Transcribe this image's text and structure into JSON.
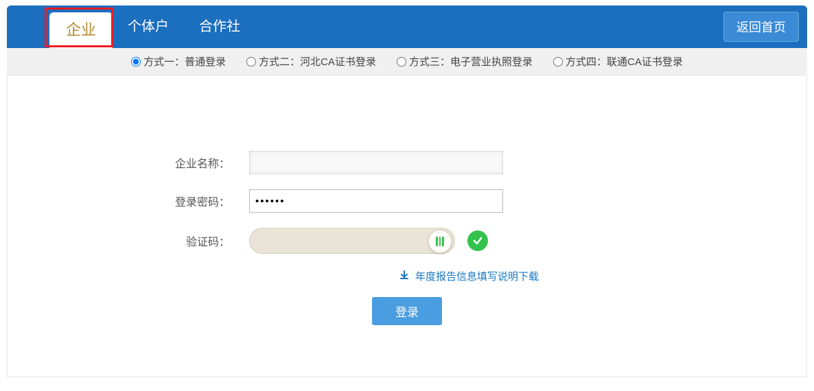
{
  "tabs": {
    "items": [
      {
        "label": "企业",
        "active": true
      },
      {
        "label": "个体户",
        "active": false
      },
      {
        "label": "合作社",
        "active": false
      }
    ]
  },
  "return_home_label": "返回首页",
  "modes": {
    "items": [
      {
        "label": "方式一：普通登录",
        "selected": true
      },
      {
        "label": "方式二：河北CA证书登录",
        "selected": false
      },
      {
        "label": "方式三：电子营业执照登录",
        "selected": false
      },
      {
        "label": "方式四：联通CA证书登录",
        "selected": false
      }
    ]
  },
  "form": {
    "company_label": "企业名称：",
    "company_value": "",
    "password_label": "登录密码：",
    "password_value": "••••••",
    "captcha_label": "验证码：",
    "captcha_success": true
  },
  "download_link_text": "年度报告信息填写说明下载",
  "login_button_label": "登录"
}
